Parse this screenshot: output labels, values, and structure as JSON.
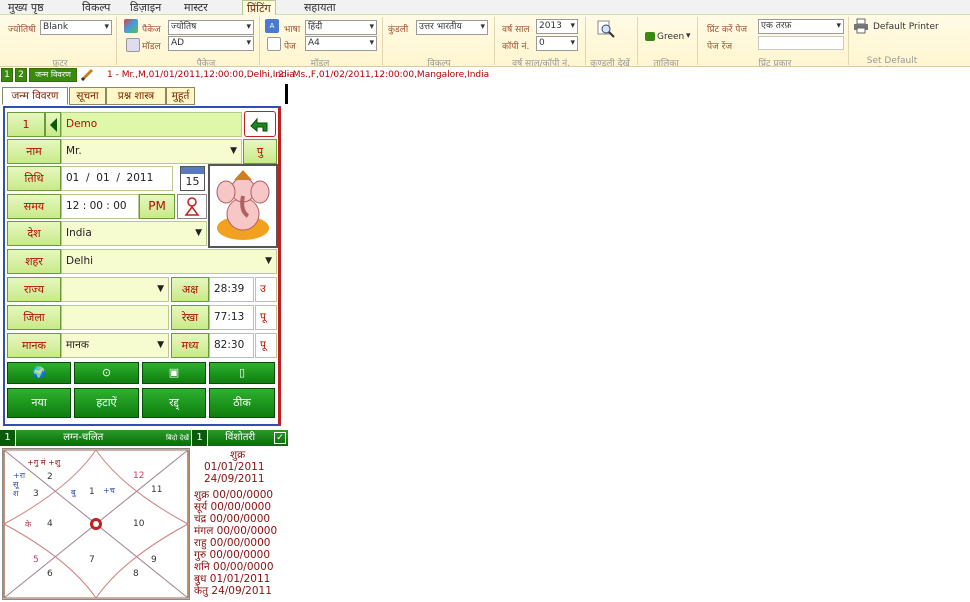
{
  "menu": {
    "tabs": [
      "मुख्य पृष्ठ",
      "विकल्प",
      "डिज़ाइन",
      "मास्टर",
      "प्रिंटिंग",
      "सहायता"
    ],
    "active": 4
  },
  "ribbon": {
    "jyotishi_label": "ज्योतिषी",
    "jyotishi_value": "Blank",
    "group_footer": "फ़ूटर",
    "package_label": "पैकेज",
    "package_value": "ज्योतिष",
    "model_label": "मॉडल",
    "model_value": "AD",
    "group_package": "पैकेज",
    "bhasha_label": "भाषा",
    "bhasha_value": "हिंदी",
    "page_label": "पेज",
    "page_value": "A4",
    "group_model": "मॉडल",
    "kundli_label": "कुंडली",
    "kundli_value": "उत्तर भारतीय",
    "group_options": "विकल्प",
    "varsh_label": "वर्ष साल",
    "varsh_value": "2013",
    "copy_label": "कॉपी नं.",
    "copy_value": "0",
    "group_year": "वर्ष साल/कॉपी नं.",
    "group_kundli_view": "कुण्डली देखें",
    "color_label": "Green",
    "group_table": "तालिका",
    "print_pages_label": "प्रिंट करें पेज",
    "print_pages_value": "एक तरफ़",
    "page_range_label": "पेज रेंज",
    "group_print_type": "प्रिंट प्रकार",
    "default_printer_label": "Default Printer",
    "group_set_default": "Set Default Printer"
  },
  "strip": {
    "btn1": "1",
    "btn2": "2",
    "btn3": "जन्म विवरण",
    "record1": "1 - Mr.,M,01/01/2011,12:00:00,Delhi,India",
    "record2": "2 - Ms.,F,01/02/2011,12:00:00,Mangalore,India"
  },
  "tabs": [
    "जन्म विवरण",
    "सूचना",
    "प्रश्न शास्त्र",
    "मुहूर्त"
  ],
  "form": {
    "record_no": "1",
    "name_value": "Demo",
    "naam_label": "नाम",
    "title_value": "Mr.",
    "gender_btn": "पु",
    "tithi_label": "तिथि",
    "day": "01",
    "month": "01",
    "year": "2011",
    "cal_day": "15",
    "samay_label": "समय",
    "hour": "12",
    "minute": "00",
    "second": "00",
    "ampm": "PM",
    "desh_label": "देश",
    "country": "India",
    "shahar_label": "शहर",
    "city": "Delhi",
    "rajya_label": "राज्य",
    "state": "",
    "aksh_label": "अक्ष",
    "aksh_value": "28:39",
    "aksh_dir": "उ",
    "zila_label": "जिला",
    "district": "",
    "rekha_label": "रेखा",
    "rekha_value": "77:13",
    "rekha_dir": "पू",
    "manak_label": "मानक",
    "manak_value": "मानक",
    "madhya_label": "मध्य",
    "madhya_value": "82:30",
    "madhya_dir": "पू",
    "btn_new": "नया",
    "btn_delete": "हटाऐं",
    "btn_cancel": "रद्द्",
    "btn_ok": "ठीक"
  },
  "lagna": {
    "num": "1",
    "title": "लग्न-चलित",
    "right": "बिंदो देखें",
    "houses": [
      "1",
      "2",
      "3",
      "4",
      "5",
      "6",
      "7",
      "8",
      "9",
      "10",
      "11",
      "12"
    ],
    "planets": {
      "h12": "+गु मं  +शु",
      "h2": "+रा\nसू\nश",
      "h4": "के",
      "h1a": "बु",
      "h1b": "+च"
    }
  },
  "vimshottari": {
    "num": "1",
    "title": "विंशोतरी",
    "head": "शुक्र",
    "start": "01/01/2011",
    "end": "24/09/2011",
    "rows": [
      "शुक्र 00/00/0000",
      "सूर्य 00/00/0000",
      "चंद्र 00/00/0000",
      "मंगल 00/00/0000",
      "राहु 00/00/0000",
      "गुरु 00/00/0000",
      "शनि 00/00/0000",
      "बुध 01/01/2011",
      "केतु 24/09/2011"
    ]
  },
  "colors": {
    "green": "#0e7e0e",
    "label_red": "#b01000",
    "accent_blue": "#3050b0"
  }
}
